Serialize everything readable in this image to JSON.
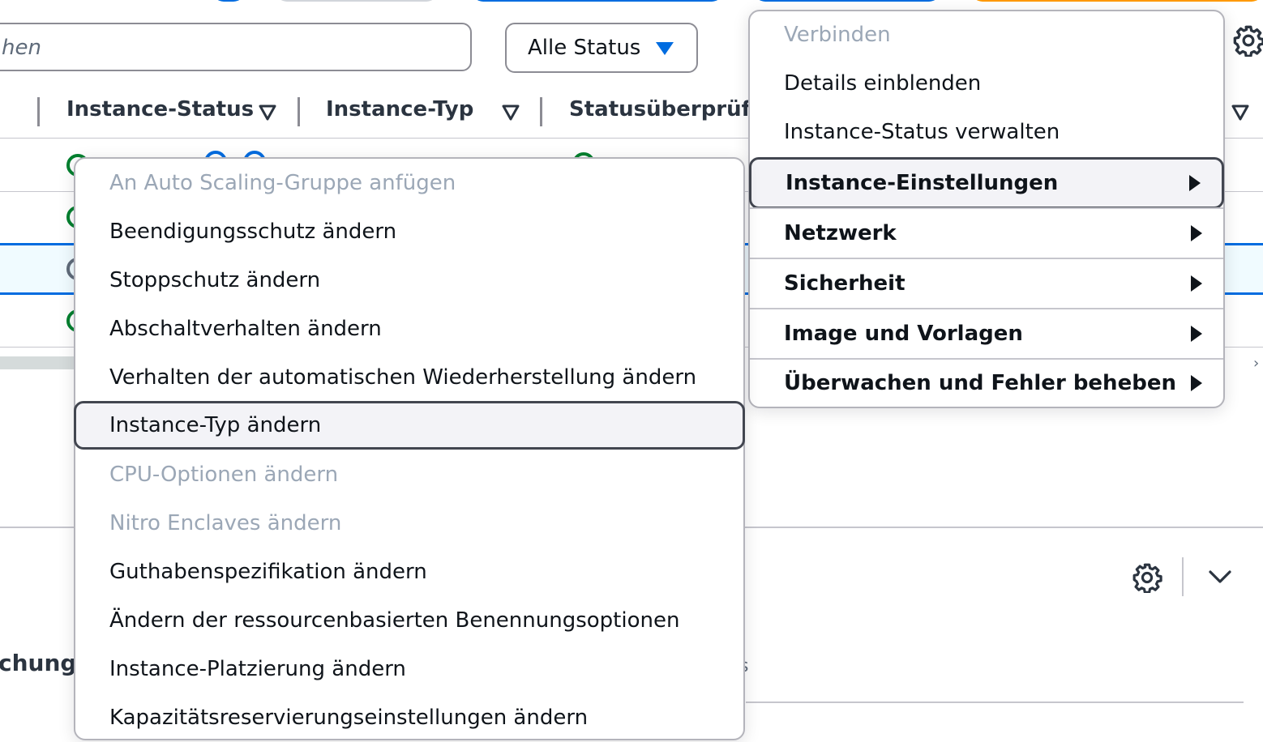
{
  "toolbar": {
    "search_placeholder_visible": "hen",
    "status_filter_label": "Alle Status"
  },
  "table": {
    "headers": [
      "Instance-Status",
      "Instance-Typ",
      "Statusüberprüfu"
    ]
  },
  "actions_menu": {
    "items": [
      {
        "label": "Verbinden",
        "disabled": true
      },
      {
        "label": "Details einblenden",
        "disabled": false
      },
      {
        "label": "Instance-Status verwalten",
        "disabled": false
      },
      {
        "label": "Instance-Einstellungen",
        "group": true,
        "active": true
      },
      {
        "label": "Netzwerk",
        "group": true
      },
      {
        "label": "Sicherheit",
        "group": true
      },
      {
        "label": "Image und Vorlagen",
        "group": true
      },
      {
        "label": "Überwachen und Fehler beheben",
        "group": true
      }
    ]
  },
  "settings_submenu": {
    "items": [
      {
        "label": "An Auto Scaling-Gruppe anfügen",
        "disabled": true
      },
      {
        "label": "Beendigungsschutz ändern"
      },
      {
        "label": "Stoppschutz ändern"
      },
      {
        "label": "Abschaltverhalten ändern"
      },
      {
        "label": "Verhalten der automatischen Wiederherstellung ändern"
      },
      {
        "label": "Instance-Typ ändern",
        "focused": true
      },
      {
        "label": "CPU-Optionen ändern",
        "disabled": true
      },
      {
        "label": "Nitro Enclaves ändern",
        "disabled": true
      },
      {
        "label": "Guthabenspezifikation ändern"
      },
      {
        "label": "Ändern der ressourcenbasierten Benennungsoptionen"
      },
      {
        "label": "Instance-Platzierung ändern"
      },
      {
        "label": "Kapazitätsreservierungseinstellungen ändern"
      }
    ]
  },
  "lower_panel": {
    "partial_heading": "chung",
    "partial_text": "s"
  },
  "colors": {
    "accent_blue": "#006ce0",
    "status_green": "#00802f",
    "orange": "#ff9900"
  },
  "icons": [
    "gear-icon",
    "chevron-down-icon",
    "caret-down-icon",
    "sort-icon",
    "submenu-arrow-icon",
    "status-icon"
  ]
}
